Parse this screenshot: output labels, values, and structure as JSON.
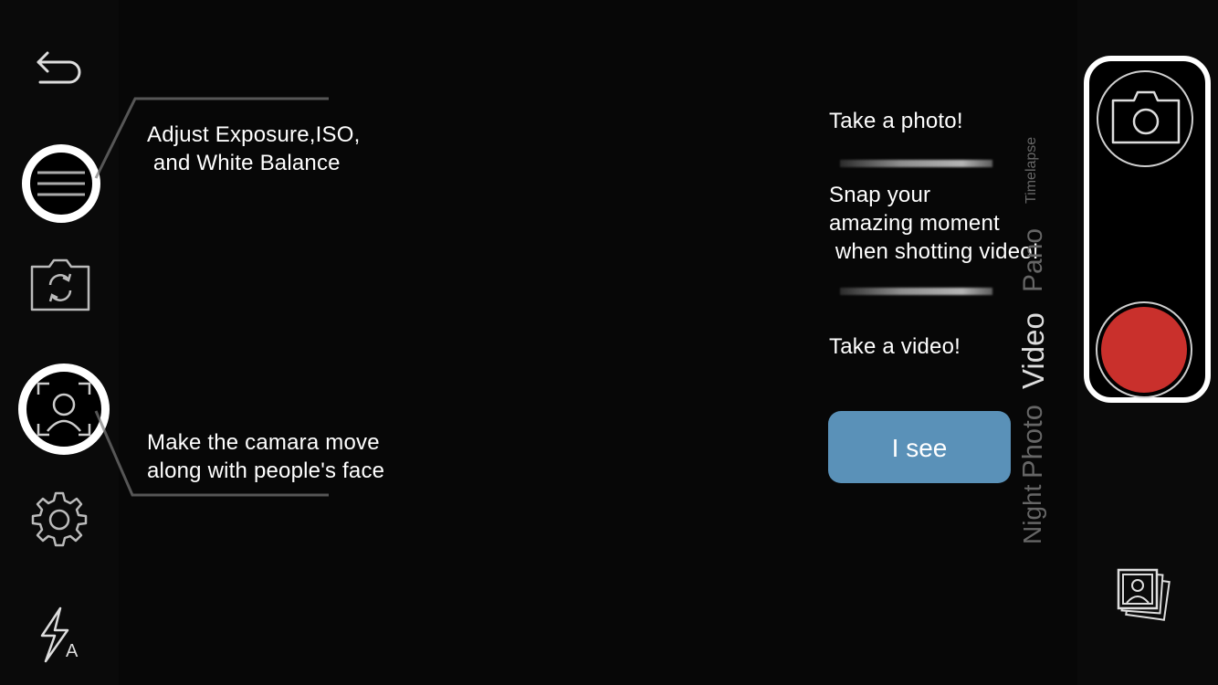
{
  "tooltips": {
    "exposure": "Adjust Exposure,ISO,\n and White Balance",
    "face_tracking": "Make the camara move\nalong with people's face",
    "take_photo": "Take a photo!",
    "snap_video": "Snap your\namazing moment\n when shotting video!",
    "take_video": "Take a video!"
  },
  "dismiss_button": {
    "label": "I see"
  },
  "modes": [
    "Night",
    "Photo",
    "Video",
    "Pano",
    "Timelapse"
  ],
  "active_mode": "Video",
  "icons": {
    "back": "back-arrow-icon",
    "exposure": "exposure-sliders-icon",
    "switch_camera": "switch-camera-icon",
    "face_tracking": "face-tracking-icon",
    "settings": "gear-icon",
    "flash": "flash-auto-icon",
    "photo_capture": "camera-icon",
    "gallery": "gallery-icon"
  },
  "flash_mode_letter": "A",
  "colors": {
    "record": "#c9302c",
    "dismiss_button": "#5a91b8",
    "background": "#070707"
  }
}
